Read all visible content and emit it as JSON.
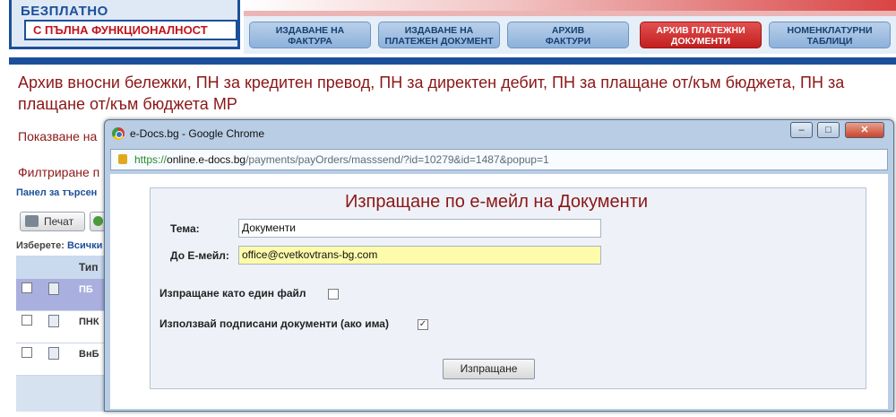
{
  "header": {
    "logo_line1": "БЕЗПЛАТНО",
    "logo_line2": "С ПЪЛНА ФУНКЦИОНАЛНОСТ",
    "tabs": [
      {
        "line1": "ИЗДАВАНЕ НА",
        "line2": "ФАКТУРА"
      },
      {
        "line1": "ИЗДАВАНЕ НА",
        "line2": "ПЛАТЕЖЕН ДОКУМЕНТ"
      },
      {
        "line1": "АРХИВ",
        "line2": "ФАКТУРИ"
      },
      {
        "line1": "АРХИВ ПЛАТЕЖНИ",
        "line2": "ДОКУМЕНТИ"
      },
      {
        "line1": "НОМЕНКЛАТУРНИ",
        "line2": "ТАБЛИЦИ"
      }
    ],
    "active_tab_color": "#c21f1f"
  },
  "page": {
    "title": "Архив вносни бележки, ПН за кредитен превод, ПН за директен дебит, ПН за плащане от/към бюджета, ПН за плащане от/към бюджета МР",
    "subtitle": "Показване на",
    "filter_title": "Филтриране п",
    "panel_link": "Панел за търсен",
    "print_label": "Печат",
    "select_prefix": "Изберете:",
    "select_all": "Всички"
  },
  "grid": {
    "header_type": "Тип",
    "rows": [
      {
        "type": "ПБ",
        "selected": true
      },
      {
        "type": "ПНК",
        "selected": false
      },
      {
        "type": "ВнБ",
        "selected": false
      }
    ]
  },
  "popup": {
    "title": "e-Docs.bg - Google Chrome",
    "url_scheme": "https://",
    "url_host": "online.e-docs.bg",
    "url_path": "/payments/payOrders/masssend/?id=10279&id=1487&popup=1",
    "form_title": "Изпращане по е-мейл на Документи",
    "subject_label": "Тема:",
    "subject_value": "Документи",
    "email_label": "До Е-мейл:",
    "email_value": "office@cvetkovtrans-bg.com",
    "single_file_label": "Изпращане като един файл",
    "single_file_checked": false,
    "signed_docs_label": "Използвай подписани документи (ако има)",
    "signed_docs_checked": true,
    "send_button": "Изпращане"
  }
}
